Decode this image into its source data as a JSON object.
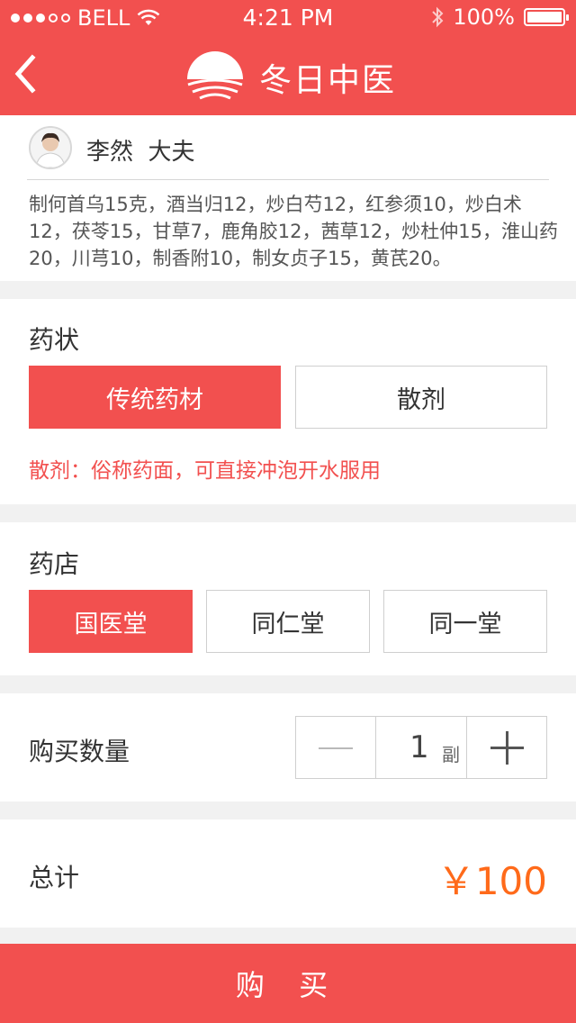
{
  "status_bar": {
    "carrier": "BELL",
    "time": "4:21 PM",
    "battery": "100%"
  },
  "nav": {
    "title": "冬日中医",
    "back_icon": "chevron-left-icon",
    "logo_icon": "sun-over-waves-icon"
  },
  "doctor": {
    "name": "李然",
    "title": "大夫"
  },
  "prescription": "制何首乌15克，酒当归12，炒白芍12，红参须10，炒白术12，茯苓15，甘草7，鹿角胶12，茜草12，炒杜仲15，淮山药20，川芎10，制香附10，制女贞子15，黄芪20。",
  "form": {
    "label": "药状",
    "options": [
      "传统药材",
      "散剂"
    ],
    "selected": "传统药材",
    "note": "散剂：俗称药面，可直接冲泡开水服用"
  },
  "pharmacy": {
    "label": "药店",
    "options": [
      "国医堂",
      "同仁堂",
      "同一堂"
    ],
    "selected": "国医堂"
  },
  "quantity": {
    "label": "购买数量",
    "value": "1",
    "unit": "副"
  },
  "total": {
    "label": "总计",
    "value": "￥100"
  },
  "buy_label": "购 买",
  "colors": {
    "brand": "#f2504f",
    "price": "#ff6a1a"
  }
}
